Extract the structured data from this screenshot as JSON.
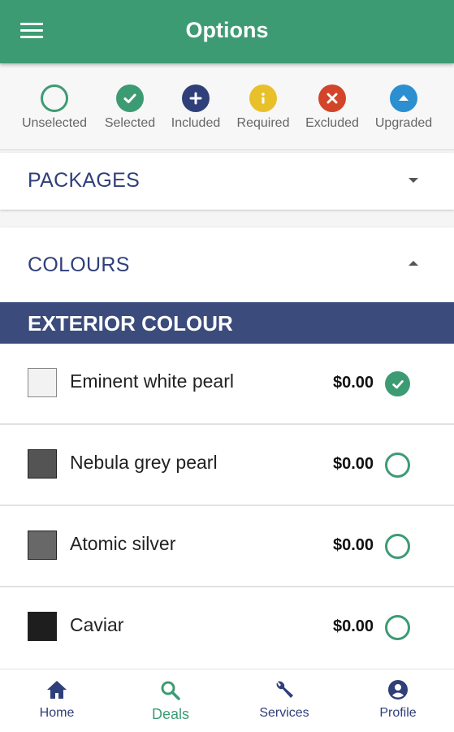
{
  "appbar": {
    "title": "Options",
    "menu_icon": "menu-icon"
  },
  "legend": [
    {
      "label": "Unselected",
      "icon": "unselected-icon",
      "color": "#3d9b74"
    },
    {
      "label": "Selected",
      "icon": "check-circle-icon",
      "color": "#3d9b74"
    },
    {
      "label": "Included",
      "icon": "plus-circle-icon",
      "color": "#2f3f79"
    },
    {
      "label": "Required",
      "icon": "info-circle-icon",
      "color": "#e8c12a"
    },
    {
      "label": "Excluded",
      "icon": "close-circle-icon",
      "color": "#d2452a"
    },
    {
      "label": "Upgraded",
      "icon": "arrow-up-circle-icon",
      "color": "#2b8fd0"
    }
  ],
  "packages": {
    "title": "PACKAGES"
  },
  "colours": {
    "title": "COLOURS"
  },
  "exterior": {
    "title": "EXTERIOR COLOUR",
    "items": [
      {
        "name": "Eminent white pearl",
        "price": "$0.00",
        "swatch": "#f2f2f2",
        "status": "selected"
      },
      {
        "name": "Nebula grey pearl",
        "price": "$0.00",
        "swatch": "#545454",
        "status": "unselected"
      },
      {
        "name": "Atomic silver",
        "price": "$0.00",
        "swatch": "#686868",
        "status": "unselected"
      },
      {
        "name": "Caviar",
        "price": "$0.00",
        "swatch": "#1e1e1e",
        "status": "unselected"
      }
    ]
  },
  "nav": [
    {
      "label": "Home",
      "icon": "home-icon",
      "active": false
    },
    {
      "label": "Deals",
      "icon": "search-icon",
      "active": true
    },
    {
      "label": "Services",
      "icon": "wrench-icon",
      "active": false
    },
    {
      "label": "Profile",
      "icon": "profile-icon",
      "active": false
    }
  ],
  "colors": {
    "accent": "#3d9b74",
    "navy": "#2f3f79"
  }
}
